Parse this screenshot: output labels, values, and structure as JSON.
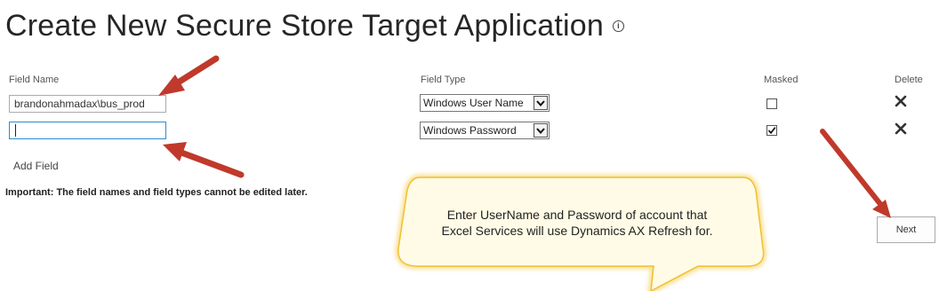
{
  "page": {
    "title": "Create New Secure Store Target Application",
    "info_icon": "info-icon"
  },
  "columns": {
    "field_name": "Field Name",
    "field_type": "Field Type",
    "masked": "Masked",
    "delete": "Delete"
  },
  "fields": [
    {
      "name_value": "brandonahmadax\\bus_prod",
      "type": "Windows User Name",
      "masked": false,
      "delete_icon": "close-icon"
    },
    {
      "name_value": "",
      "type": "Windows Password",
      "masked": true,
      "delete_icon": "close-icon"
    }
  ],
  "actions": {
    "add_field": "Add Field",
    "next": "Next"
  },
  "notice": "Important: The field names and field types cannot be edited later.",
  "callout": {
    "line1": "Enter UserName and Password of account that",
    "line2": "Excel Services will use Dynamics AX Refresh for."
  },
  "colors": {
    "annotation_arrow": "#c0392b",
    "callout_fill": "#fffbe6",
    "callout_border": "#f5c842",
    "focus_border": "#2a8dd4"
  }
}
